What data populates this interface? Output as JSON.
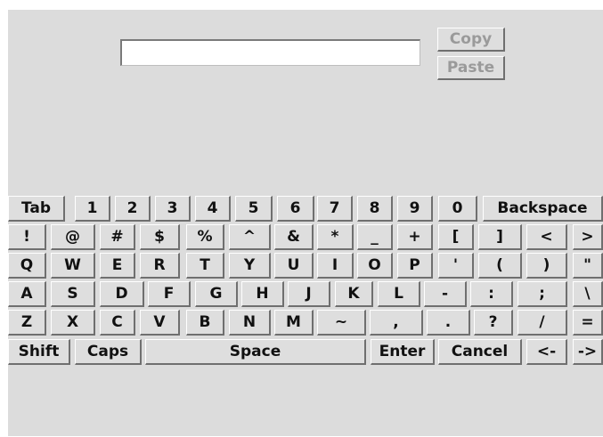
{
  "text_field": {
    "value": "",
    "placeholder": ""
  },
  "clipboard": {
    "copy_label": "Copy",
    "paste_label": "Paste"
  },
  "keyboard": {
    "row1": [
      "Tab",
      "1",
      "2",
      "3",
      "4",
      "5",
      "6",
      "7",
      "8",
      "9",
      "0",
      "Backspace"
    ],
    "row2": [
      "!",
      "@",
      "#",
      "$",
      "%",
      "^",
      "&",
      "*",
      "_",
      "+",
      "[",
      "]",
      "<",
      ">"
    ],
    "row3": [
      "Q",
      "W",
      "E",
      "R",
      "T",
      "Y",
      "U",
      "I",
      "O",
      "P",
      "'",
      "(",
      ")",
      "\""
    ],
    "row4": [
      "A",
      "S",
      "D",
      "F",
      "G",
      "H",
      "J",
      "K",
      "L",
      "-",
      ":",
      ";",
      "\\"
    ],
    "row5": [
      "Z",
      "X",
      "C",
      "V",
      "B",
      "N",
      "M",
      "~",
      ",",
      ".",
      "?",
      "/",
      "="
    ],
    "row6": [
      "Shift",
      "Caps",
      "Space",
      "Enter",
      "Cancel",
      "<-",
      "->"
    ]
  }
}
